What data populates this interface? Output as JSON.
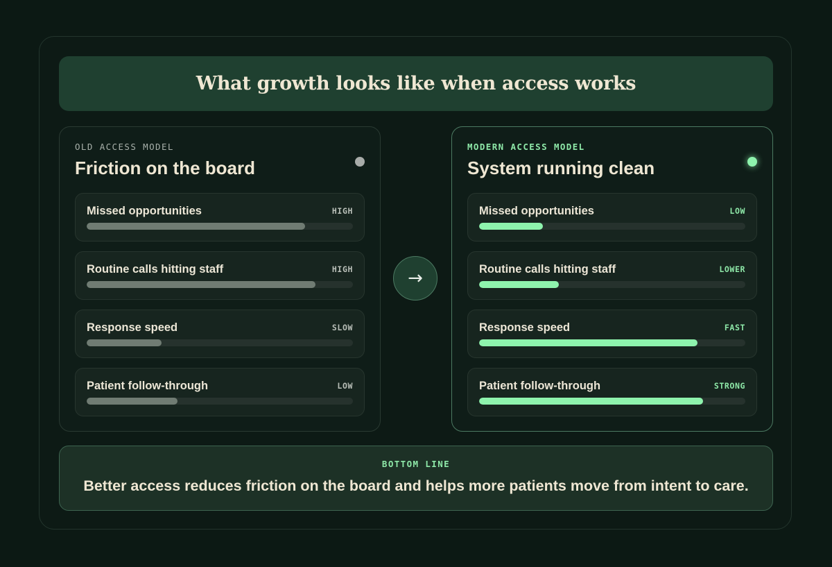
{
  "header": {
    "title": "What growth looks like when access works"
  },
  "old_model": {
    "eyebrow": "OLD ACCESS MODEL",
    "heading": "Friction on the board",
    "status_color": "#a8aca9",
    "metrics": [
      {
        "label": "Missed opportunities",
        "level": "HIGH",
        "fill": 0.82
      },
      {
        "label": "Routine calls hitting staff",
        "level": "HIGH",
        "fill": 0.86
      },
      {
        "label": "Response speed",
        "level": "SLOW",
        "fill": 0.28
      },
      {
        "label": "Patient follow-through",
        "level": "LOW",
        "fill": 0.34
      }
    ]
  },
  "transition": {
    "icon": "arrow-right-icon",
    "glyph": "→"
  },
  "new_model": {
    "eyebrow": "MODERN ACCESS MODEL",
    "heading": "System running clean",
    "status_color": "#8ef3ad",
    "metrics": [
      {
        "label": "Missed opportunities",
        "level": "LOW",
        "fill": 0.24
      },
      {
        "label": "Routine calls hitting staff",
        "level": "LOWER",
        "fill": 0.3
      },
      {
        "label": "Response speed",
        "level": "FAST",
        "fill": 0.82
      },
      {
        "label": "Patient follow-through",
        "level": "STRONG",
        "fill": 0.84
      }
    ]
  },
  "bottom_line": {
    "eyebrow": "BOTTOM LINE",
    "text": "Better access reduces friction on the board and helps more patients move from intent to care."
  },
  "colors": {
    "background": "#0c1914",
    "banner": "#1f4030",
    "accent_green": "#8ef3ad",
    "old_bar": "#707c73",
    "heading_text": "#efe7d3"
  }
}
